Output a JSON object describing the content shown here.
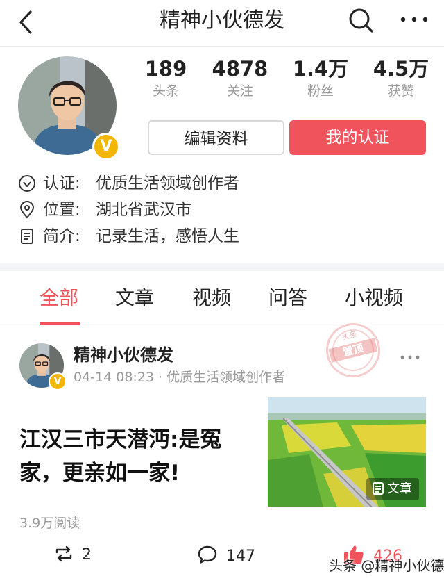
{
  "header": {
    "title": "精神小伙德发"
  },
  "profile": {
    "verified_badge": "V",
    "stats": [
      {
        "value": "189",
        "label": "头条"
      },
      {
        "value": "4878",
        "label": "关注"
      },
      {
        "value": "1.4万",
        "label": "粉丝"
      },
      {
        "value": "4.5万",
        "label": "获赞"
      }
    ],
    "buttons": {
      "edit": "编辑资料",
      "verify": "我的认证"
    },
    "info": {
      "verification_label": "认证:",
      "verification_value": "优质生活领域创作者",
      "location_label": "位置:",
      "location_value": "湖北省武汉市",
      "bio_label": "简介:",
      "bio_value": "记录生活，感悟人生"
    }
  },
  "tabs": [
    "全部",
    "文章",
    "视频",
    "问答",
    "小视频"
  ],
  "active_tab": "全部",
  "post": {
    "author": "精神小伙德发",
    "badge": "V",
    "meta": "04-14 08:23 · 优质生活领域创作者",
    "stamp_top": "头条",
    "stamp_main": "置顶",
    "headline": "江汉三市天潜沔:是冤家，更亲如一家!",
    "thumbnail_label": "文章",
    "reads": "3.9万阅读",
    "reposts": "2",
    "comments": "147",
    "likes": "426"
  },
  "watermark": "头条 @精神小伙德发",
  "colors": {
    "accent": "#f0535c",
    "badge": "#f2b705",
    "muted_text": "#999999",
    "page_background": "#f4f5f6"
  },
  "icons": {
    "back": "back-arrow-icon",
    "search": "search-icon",
    "more": "more-dots-icon",
    "verification": "verified-check-icon",
    "location": "location-pin-icon",
    "bio": "document-icon",
    "repost": "repost-icon",
    "comment": "comment-bubble-icon",
    "like": "thumbs-up-icon",
    "article": "article-icon"
  }
}
